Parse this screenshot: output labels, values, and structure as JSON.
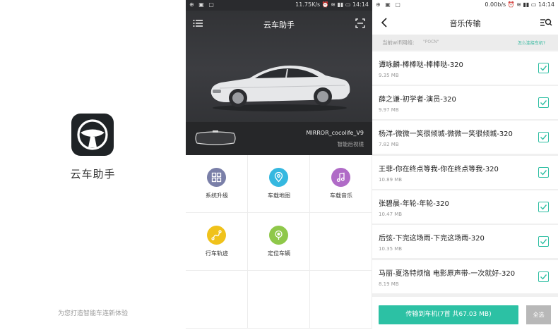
{
  "splash": {
    "app_name": "云车助手",
    "slogan": "为您打造智能车连新体验"
  },
  "home": {
    "status": {
      "left": "",
      "speed": "11.75K/s",
      "time": "14:14"
    },
    "title": "云车助手",
    "device": {
      "name": "MIRROR_cocolife_V9",
      "type": "智能后视镜"
    },
    "tiles": [
      {
        "label": "系统升级",
        "color": "#7a7fa8",
        "icon": "grid-icon"
      },
      {
        "label": "车载地图",
        "color": "#35b8e0",
        "icon": "map-pin-icon"
      },
      {
        "label": "车载音乐",
        "color": "#b06bc7",
        "icon": "music-note-icon"
      },
      {
        "label": "行车轨迹",
        "color": "#f0c21b",
        "icon": "route-icon"
      },
      {
        "label": "定位车辆",
        "color": "#8fc84a",
        "icon": "location-icon"
      }
    ]
  },
  "music": {
    "status": {
      "speed": "0.00b/s",
      "time": "14:14"
    },
    "title": "音乐传输",
    "wifi_label": "当前wifi网络:",
    "wifi_ssid": "\"POCN\"",
    "wifi_link": "怎么连接车机?",
    "songs": [
      {
        "name": "谭咏麟-棒棒哒-棒棒哒-320",
        "size": "9.35 MB"
      },
      {
        "name": "薛之谦-初学者-演员-320",
        "size": "9.97 MB"
      },
      {
        "name": "杨洋-微微一笑很倾城-微微一笑很倾城-320",
        "size": "7.82 MB"
      },
      {
        "name": "王菲-你在终点等我-你在终点等我-320",
        "size": "10.89 MB"
      },
      {
        "name": "张碧晨-年轮-年轮-320",
        "size": "10.47 MB"
      },
      {
        "name": "后弦-下完这场雨-下完这场雨-320",
        "size": "10.35 MB"
      },
      {
        "name": "马丽-夏洛特烦恼 电影原声带-一次就好-320",
        "size": "8.19 MB"
      }
    ],
    "transfer_label": "传输到车机(7首 共67.03 MB)",
    "select_all_label": "全选",
    "accent": "#2cc1a4"
  }
}
